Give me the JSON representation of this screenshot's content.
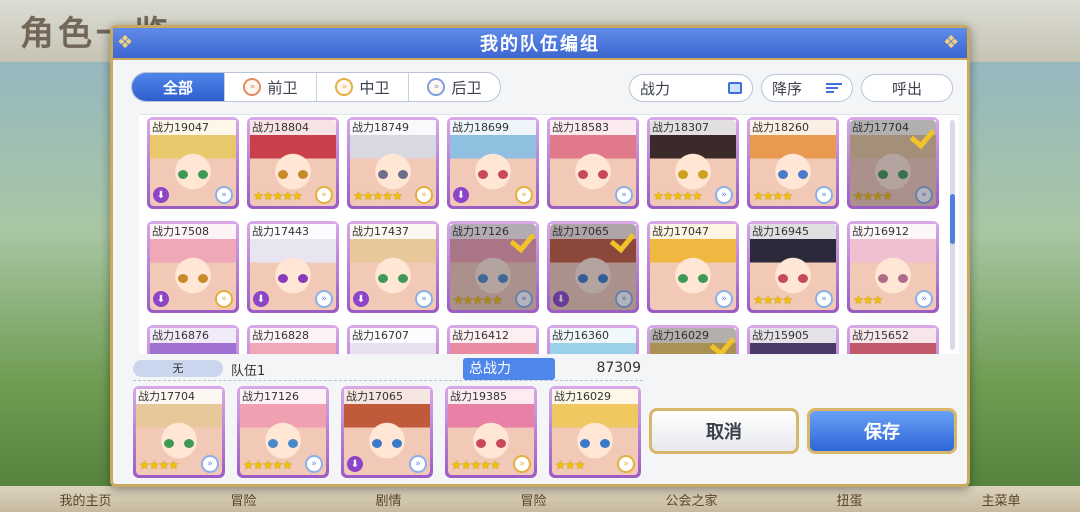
{
  "background": {
    "title": "角色一览",
    "bottom_nav": [
      "我的主页",
      "冒险",
      "剧情",
      "冒险",
      "公会之家",
      "扭蛋",
      "主菜单"
    ]
  },
  "dialog": {
    "title": "我的队伍编组",
    "tabs": [
      {
        "label": "全部",
        "active": true,
        "icon": ""
      },
      {
        "label": "前卫",
        "active": false,
        "icon": "front"
      },
      {
        "label": "中卫",
        "active": false,
        "icon": "mid"
      },
      {
        "label": "后卫",
        "active": false,
        "icon": "back"
      }
    ],
    "sort_field": "战力",
    "sort_order": "降序",
    "call_out": "呼出"
  },
  "roster": [
    {
      "power": "战力19047",
      "stars": 0,
      "fav": true,
      "pos": "back",
      "sel": false,
      "hair": "#e8c86a",
      "eye": "#3f9a55"
    },
    {
      "power": "战力18804",
      "stars": 5,
      "fav": false,
      "pos": "mid",
      "sel": false,
      "hair": "#c9404a",
      "eye": "#c68a2a"
    },
    {
      "power": "战力18749",
      "stars": 5,
      "fav": false,
      "pos": "mid",
      "sel": false,
      "hair": "#d8d8e0",
      "eye": "#6e6e8a"
    },
    {
      "power": "战力18699",
      "stars": 0,
      "fav": true,
      "pos": "mid",
      "sel": false,
      "hair": "#8fc0e0",
      "eye": "#c84a5a"
    },
    {
      "power": "战力18583",
      "stars": 0,
      "fav": false,
      "pos": "back",
      "sel": false,
      "hair": "#e07a8a",
      "eye": "#c84a5a"
    },
    {
      "power": "战力18307",
      "stars": 5,
      "fav": false,
      "pos": "back",
      "sel": false,
      "hair": "#3a2a2a",
      "eye": "#d0a020"
    },
    {
      "power": "战力18260",
      "stars": 4,
      "fav": false,
      "pos": "back",
      "sel": false,
      "hair": "#e89a50",
      "eye": "#4a7ac8"
    },
    {
      "power": "战力17704",
      "stars": 4,
      "fav": false,
      "pos": "back",
      "sel": true,
      "hair": "#e6c89a",
      "eye": "#3f9a55"
    },
    {
      "power": "战力17508",
      "stars": 0,
      "fav": true,
      "pos": "mid",
      "sel": false,
      "hair": "#f0a8b8",
      "eye": "#c88a2a"
    },
    {
      "power": "战力17443",
      "stars": 0,
      "fav": true,
      "pos": "back",
      "sel": false,
      "hair": "#e8e4f0",
      "eye": "#8a3ab8"
    },
    {
      "power": "战力17437",
      "stars": 0,
      "fav": true,
      "pos": "back",
      "sel": false,
      "hair": "#e8c89a",
      "eye": "#3f9a55"
    },
    {
      "power": "战力17126",
      "stars": 5,
      "fav": false,
      "pos": "back",
      "sel": true,
      "hair": "#f0a0b0",
      "eye": "#4a8ac8"
    },
    {
      "power": "战力17065",
      "stars": 0,
      "fav": true,
      "pos": "back",
      "sel": true,
      "hair": "#c05a3a",
      "eye": "#3a7ac8"
    },
    {
      "power": "战力17047",
      "stars": 0,
      "fav": false,
      "pos": "back",
      "sel": false,
      "hair": "#f0b840",
      "eye": "#3f9a55"
    },
    {
      "power": "战力16945",
      "stars": 4,
      "fav": false,
      "pos": "back",
      "sel": false,
      "hair": "#2a2a3a",
      "eye": "#c84a5a"
    },
    {
      "power": "战力16912",
      "stars": 3,
      "fav": false,
      "pos": "back",
      "sel": false,
      "hair": "#f0c0d0",
      "eye": "#b06a8a"
    },
    {
      "power": "战力16876",
      "stars": 0,
      "fav": false,
      "pos": "back",
      "sel": false,
      "hair": "#a070d0",
      "eye": "#6a4ab8"
    },
    {
      "power": "战力16828",
      "stars": 0,
      "fav": false,
      "pos": "back",
      "sel": false,
      "hair": "#f0a8b8",
      "eye": "#c84a5a"
    },
    {
      "power": "战力16707",
      "stars": 0,
      "fav": false,
      "pos": "back",
      "sel": false,
      "hair": "#e8e0f0",
      "eye": "#8a6ab8"
    },
    {
      "power": "战力16412",
      "stars": 0,
      "fav": false,
      "pos": "back",
      "sel": false,
      "hair": "#e88aa0",
      "eye": "#c84a5a"
    },
    {
      "power": "战力16360",
      "stars": 0,
      "fav": false,
      "pos": "back",
      "sel": false,
      "hair": "#9ad0e8",
      "eye": "#3a7ac8"
    },
    {
      "power": "战力16029",
      "stars": 0,
      "fav": false,
      "pos": "back",
      "sel": true,
      "hair": "#f0c860",
      "eye": "#3a7ac8"
    },
    {
      "power": "战力15905",
      "stars": 0,
      "fav": false,
      "pos": "back",
      "sel": false,
      "hair": "#4a3a6a",
      "eye": "#c84a5a"
    },
    {
      "power": "战力15652",
      "stars": 0,
      "fav": false,
      "pos": "back",
      "sel": false,
      "hair": "#c05a6a",
      "eye": "#c84a5a"
    }
  ],
  "team": {
    "tag": "无",
    "name": "队伍1",
    "total_label": "总战力",
    "total_value": "87309",
    "members": [
      {
        "power": "战力17704",
        "stars": 4,
        "fav": false,
        "pos": "back",
        "hair": "#e6c89a",
        "eye": "#3f9a55"
      },
      {
        "power": "战力17126",
        "stars": 5,
        "fav": false,
        "pos": "back",
        "hair": "#f0a0b0",
        "eye": "#4a8ac8"
      },
      {
        "power": "战力17065",
        "stars": 0,
        "fav": true,
        "pos": "back",
        "hair": "#c05a3a",
        "eye": "#3a7ac8"
      },
      {
        "power": "战力19385",
        "stars": 5,
        "fav": false,
        "pos": "mid",
        "hair": "#e880a8",
        "eye": "#c84a5a"
      },
      {
        "power": "战力16029",
        "stars": 3,
        "fav": false,
        "pos": "mid",
        "hair": "#f0c860",
        "eye": "#3a7ac8"
      }
    ]
  },
  "actions": {
    "cancel": "取消",
    "save": "保存"
  }
}
